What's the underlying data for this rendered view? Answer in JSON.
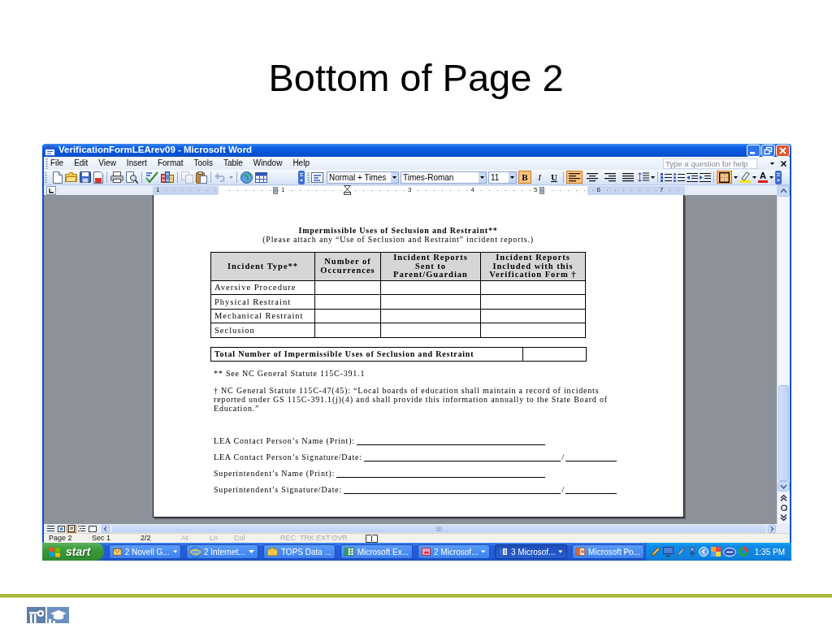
{
  "slide": {
    "title": "Bottom of Page 2"
  },
  "window": {
    "title": "VerificationFormLEArev09 - Microsoft Word"
  },
  "menu": [
    "File",
    "Edit",
    "View",
    "Insert",
    "Format",
    "Tools",
    "Table",
    "Window",
    "Help"
  ],
  "help": {
    "placeholder": "Type a question for help"
  },
  "standard_toolbar": {
    "copy_disabled": true,
    "undo_disabled": true
  },
  "formatting_toolbar": {
    "style": "Normal + Times",
    "font": "Times-Roman",
    "size": "11",
    "toggles": [
      {
        "kind": "bold",
        "label": "B",
        "on": true
      },
      {
        "kind": "italic",
        "label": "I",
        "on": false
      },
      {
        "kind": "underline",
        "label": "U",
        "on": false
      }
    ],
    "alignment": [
      {
        "selected": true
      },
      {
        "selected": false
      },
      {
        "selected": false
      },
      {
        "selected": false
      }
    ],
    "border_on": true,
    "font_color": {
      "label": "A"
    }
  },
  "ruler": {
    "marks": [
      {
        "kind": "number",
        "label": "1"
      },
      {
        "kind": "blank"
      },
      {
        "kind": "marker-number",
        "label": "1"
      },
      {
        "kind": "indent"
      },
      {
        "kind": "number",
        "label": "3"
      },
      {
        "kind": "number",
        "label": "4"
      },
      {
        "kind": "number-marker",
        "label": "5"
      },
      {
        "kind": "number",
        "label": "6"
      },
      {
        "kind": "number",
        "label": "7"
      }
    ]
  },
  "document": {
    "heading": "Impermissible Uses of Seclusion and Restraint**",
    "note": "(Please attach any “Use of Seclusion and Restraint” incident reports.)",
    "table": {
      "columns": [
        "Incident Type**",
        "Number of Occurrences",
        "Incident Reports Sent to Parent/Guardian",
        "Incident Reports Included with this Verification Form †"
      ],
      "rows": [
        "Aversive Procedure",
        "Physical Restraint",
        "Mechanical Restraint",
        "Seclusion"
      ]
    },
    "total": "Total Number of Impermissible Uses of Seclusion and Restraint",
    "footnotes": [
      "** See NC General Statute 115C-391.1",
      "† NC General Statute 115C-47(45): “Local boards of education shall maintain a record of incidents reported under GS 115C-391.1(j)(4) and shall provide this information annually to the State Board of Education.”"
    ],
    "signatures": [
      {
        "label": "LEA Contact Person’s Name (Print):",
        "kind": "name"
      },
      {
        "label": "LEA Contact Person’s Signature/Date:",
        "kind": "dated",
        "separator": "/"
      },
      {
        "label": "Superintendent’s Name (Print):",
        "kind": "name"
      },
      {
        "label": "Superintendent’s Signature/Date:",
        "kind": "dated",
        "separator": "/"
      }
    ]
  },
  "view_buttons": [
    {
      "selected": false
    },
    {
      "selected": false
    },
    {
      "selected": true
    },
    {
      "selected": false
    },
    {
      "selected": false
    }
  ],
  "status_bar": [
    {
      "text": "Page 2",
      "dimmed": false
    },
    {
      "text": "Sec 1",
      "dimmed": false
    },
    {
      "text": "2/2",
      "dimmed": false
    },
    {
      "text": "At",
      "dimmed": true
    },
    {
      "text": "Ln",
      "dimmed": true
    },
    {
      "text": "Col",
      "dimmed": true
    },
    {
      "text": "REC",
      "dimmed": true
    },
    {
      "text": "TRK",
      "dimmed": true
    },
    {
      "text": "EXT",
      "dimmed": true
    },
    {
      "text": "OVR",
      "dimmed": true
    }
  ],
  "taskbar": {
    "start": "start",
    "tasks": [
      {
        "label": "2 Novell G...",
        "kind": "group",
        "selected": false
      },
      {
        "label": "2 Internet...",
        "kind": "group",
        "selected": false
      },
      {
        "label": "TOPS Data ...",
        "kind": "single",
        "selected": false
      },
      {
        "label": "Microsoft Ex...",
        "kind": "single",
        "selected": false
      },
      {
        "label": "2 Microsof...",
        "kind": "group",
        "selected": false
      },
      {
        "label": "3 Microsof...",
        "kind": "group",
        "selected": true
      },
      {
        "label": "Microsoft Po...",
        "kind": "single",
        "selected": false
      }
    ],
    "clock": "1:35 PM"
  }
}
